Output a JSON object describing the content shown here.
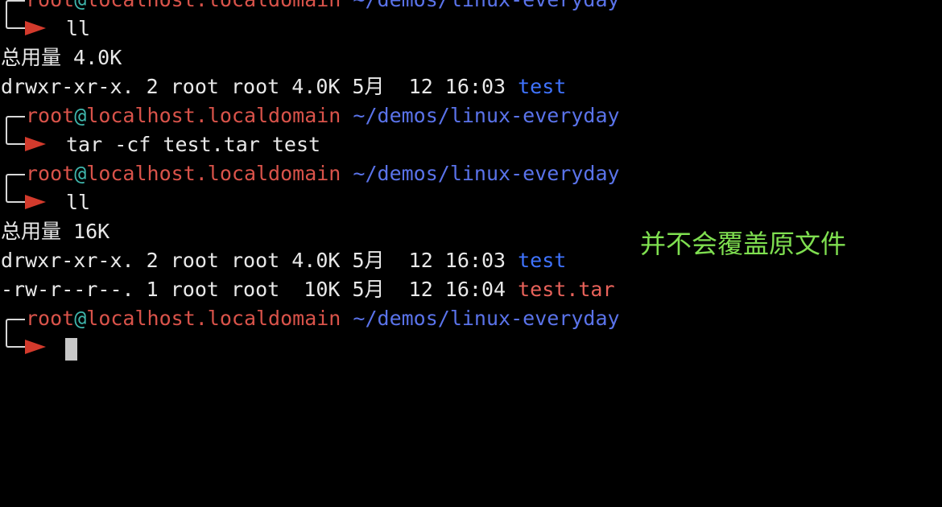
{
  "prompt": {
    "user": "root",
    "at": "@",
    "host": "localhost.localdomain",
    "path": "~/demos/linux-everyday"
  },
  "commands": {
    "ll_1": "ll",
    "tar": "tar -cf test.tar test",
    "ll_2": "ll",
    "active": ""
  },
  "output_1": {
    "total": "总用量 4.0K",
    "rows": [
      {
        "meta": "drwxr-xr-x. 2 root root 4.0K 5月  12 16:03 ",
        "name": "test"
      }
    ]
  },
  "output_2": {
    "total": "总用量 16K",
    "rows": [
      {
        "meta": "drwxr-xr-x. 2 root root 4.0K 5月  12 16:03 ",
        "name": "test"
      },
      {
        "meta": "-rw-r--r--. 1 root root  10K 5月  12 16:04 ",
        "name": "test.tar"
      }
    ]
  },
  "annotation": "并不会覆盖原文件",
  "colors": {
    "background": "#000000",
    "prompt_user": "#d9534a",
    "prompt_path": "#5a73ea",
    "directory": "#3f73ff",
    "archive": "#e8625a",
    "arrow": "#d23a2c",
    "annotation": "#7fdf50"
  },
  "icons": {
    "prompt_corner": "box-drawing-corner-icon",
    "prompt_arrow": "right-arrow-icon",
    "cursor": "block-cursor"
  }
}
